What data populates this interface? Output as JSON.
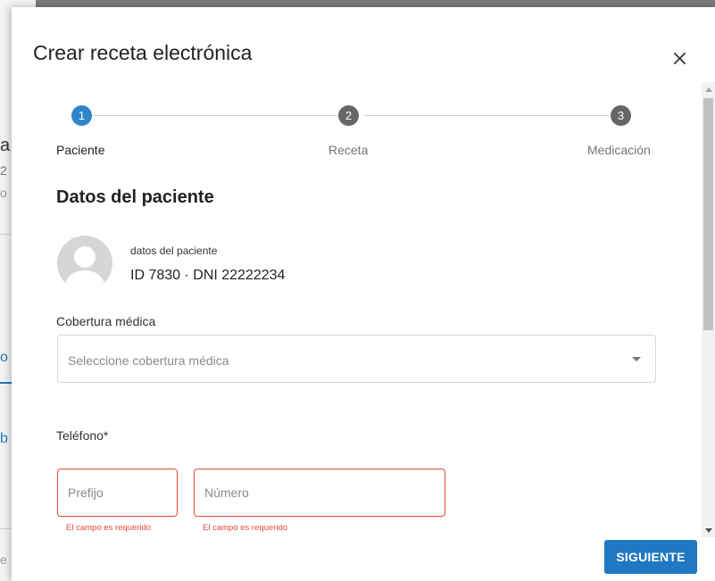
{
  "background_fragments": [
    "a",
    "2",
    "o",
    "o",
    "b",
    "e"
  ],
  "dialog": {
    "title": "Crear receta electrónica",
    "close_icon": "close-icon"
  },
  "stepper": {
    "steps": [
      {
        "number": "1",
        "label": "Paciente",
        "state": "active"
      },
      {
        "number": "2",
        "label": "Receta",
        "state": "inactive"
      },
      {
        "number": "3",
        "label": "Medicación",
        "state": "inactive"
      }
    ]
  },
  "section_title": "Datos del paciente",
  "patient": {
    "name": "datos del paciente",
    "id_line": "ID 7830 · DNI 22222234"
  },
  "coverage": {
    "label": "Cobertura médica",
    "placeholder": "Seleccione cobertura médica"
  },
  "phone": {
    "label": "Teléfono*",
    "prefix_placeholder": "Prefijo",
    "number_placeholder": "Número",
    "prefix_error": "El campo es requerido",
    "number_error": "El campo es requerido"
  },
  "actions": {
    "next_label": "SIGUIENTE"
  },
  "colors": {
    "accent": "#1f78c1",
    "step_active": "#2e86c9",
    "step_inactive": "#666666",
    "error": "#e5483b"
  }
}
